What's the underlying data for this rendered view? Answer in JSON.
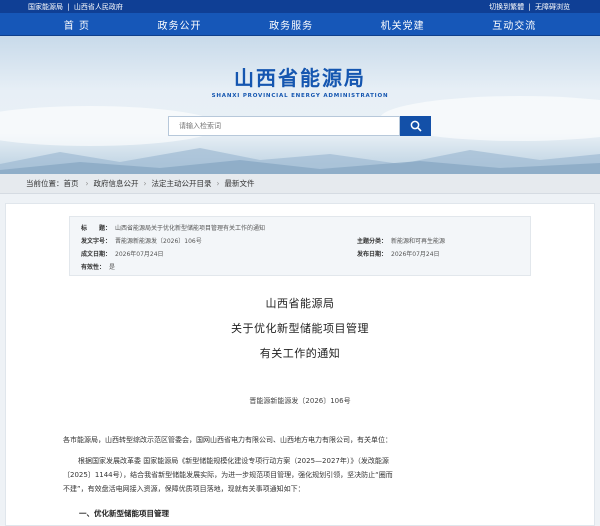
{
  "topbar": {
    "links": [
      "国家能源局",
      "山西省人民政府"
    ],
    "right": [
      "切换到繁體",
      "无障碍浏览"
    ],
    "separator": "|"
  },
  "nav": [
    "首 页",
    "政务公开",
    "政务服务",
    "机关党建",
    "互动交流"
  ],
  "logo": {
    "cn": "山西省能源局",
    "en": "SHANXI PROVINCIAL ENERGY ADMINISTRATION"
  },
  "search": {
    "placeholder": "请输入检索词"
  },
  "breadcrumb": {
    "prefix": "当前位置：",
    "items": [
      "首页",
      "政府信息公开",
      "法定主动公开目录",
      "最新文件"
    ]
  },
  "meta": {
    "title_label": "标　　题：",
    "title_value": "山西省能源局关于优化新型储能项目管理有关工作的通知",
    "docno_label": "发文字号：",
    "docno_value": "晋能源新能源发〔2026〕106号",
    "date_label": "成文日期：",
    "date_value": "2026年07月24日",
    "valid_label": "有效性：",
    "valid_value": "是",
    "subject_label": "主题分类：",
    "subject_value": "新能源和可再生能源",
    "pub_label": "发布日期：",
    "pub_value": "2026年07月24日"
  },
  "doc": {
    "org": "山西省能源局",
    "title1": "关于优化新型储能项目管理",
    "title2": "有关工作的通知",
    "number": "晋能源新能源发〔2026〕106号",
    "recipients": "各市能源局，山西转型综改示范区管委会，国网山西省电力有限公司、山西地方电力有限公司，有关单位：",
    "body_line1": "根据国家发展改革委 国家能源局《新型储能规模化建设专项行动方案（2025—2027年）》（发改能源",
    "body_line2": "〔2025〕1144号），结合我省新型储能发展实际，为进一步规范项目管理，强化规划引领，坚决防止“圈而",
    "body_line3": "不建”，有效盘活电网接入资源，保障优质项目落地，现就有关事项通知如下：",
    "section1": "一、优化新型储能项目管理"
  }
}
